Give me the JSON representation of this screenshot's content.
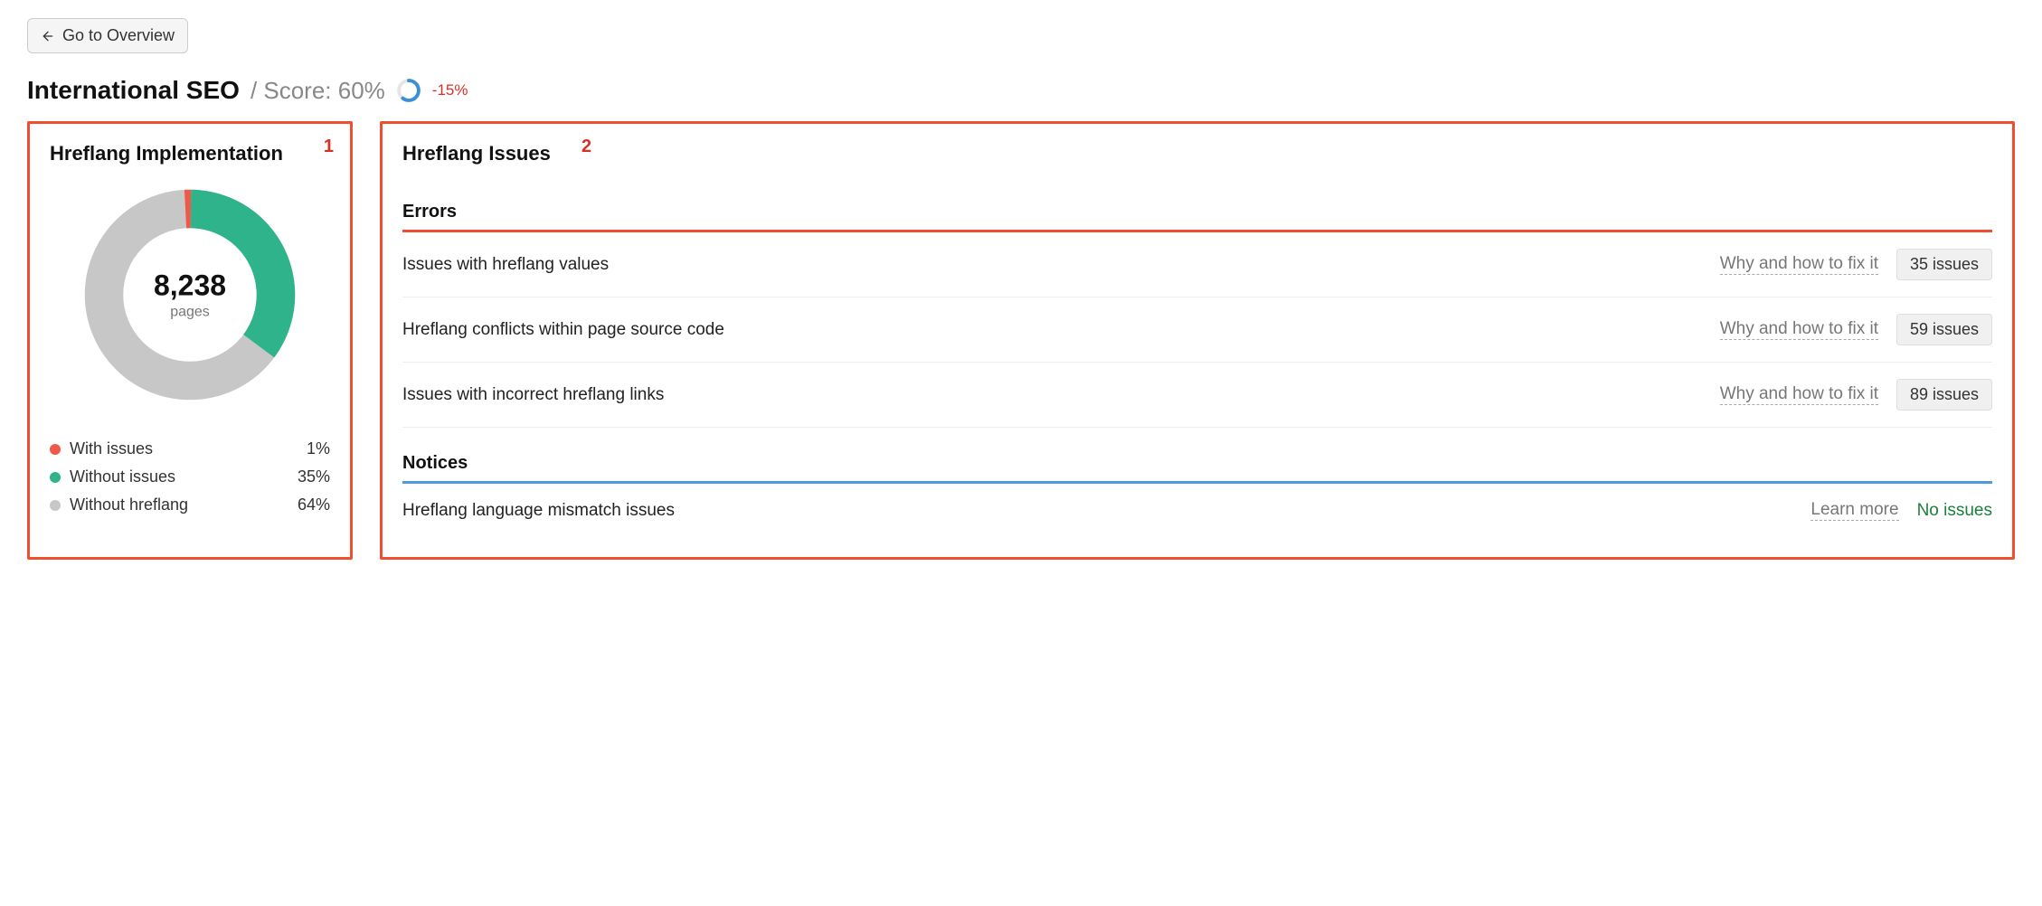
{
  "back_button": "Go to Overview",
  "page_title": "International SEO",
  "score_label": "/ Score: 60%",
  "score_percent": 60,
  "delta": "-15%",
  "annotation1": "1",
  "annotation2": "2",
  "implementation": {
    "title": "Hreflang Implementation",
    "total": "8,238",
    "unit": "pages",
    "legend": [
      {
        "label": "With issues",
        "value": "1%",
        "color": "#f0594a"
      },
      {
        "label": "Without issues",
        "value": "35%",
        "color": "#2fb38a"
      },
      {
        "label": "Without hreflang",
        "value": "64%",
        "color": "#c7c7c7"
      }
    ]
  },
  "issues": {
    "title": "Hreflang Issues",
    "errors_label": "Errors",
    "notices_label": "Notices",
    "fix_link": "Why and how to fix it",
    "learn_more": "Learn more",
    "no_issues": "No issues",
    "errors": [
      {
        "name": "Issues with hreflang values",
        "count": "35 issues"
      },
      {
        "name": "Hreflang conflicts within page source code",
        "count": "59 issues"
      },
      {
        "name": "Issues with incorrect hreflang links",
        "count": "89 issues"
      }
    ],
    "notices": [
      {
        "name": "Hreflang language mismatch issues"
      }
    ]
  },
  "chart_data": {
    "type": "pie",
    "title": "Hreflang Implementation",
    "categories": [
      "With issues",
      "Without issues",
      "Without hreflang"
    ],
    "values": [
      1,
      35,
      64
    ],
    "total_pages": 8238
  }
}
